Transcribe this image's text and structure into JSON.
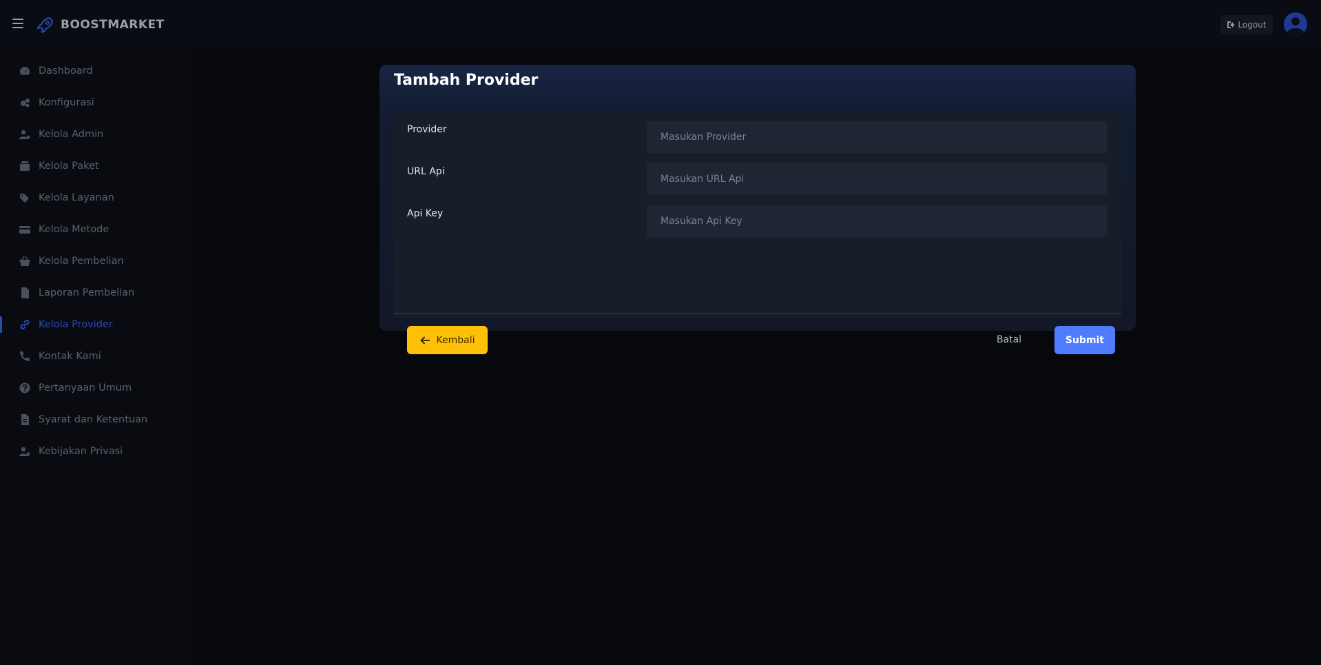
{
  "header": {
    "brand_name": "BOOSTMARKET",
    "logout_label": "Logout"
  },
  "sidebar": {
    "items": [
      {
        "label": "Dashboard",
        "icon": "dashboard-icon"
      },
      {
        "label": "Konfigurasi",
        "icon": "cogs-icon"
      },
      {
        "label": "Kelola Admin",
        "icon": "user-cog-icon"
      },
      {
        "label": "Kelola Paket",
        "icon": "box-icon"
      },
      {
        "label": "Kelola Layanan",
        "icon": "tags-icon"
      },
      {
        "label": "Kelola Metode",
        "icon": "credit-card-icon"
      },
      {
        "label": "Kelola Pembelian",
        "icon": "basket-icon"
      },
      {
        "label": "Laporan Pembelian",
        "icon": "file-icon"
      },
      {
        "label": "Kelola Provider",
        "icon": "link-icon",
        "active": true
      },
      {
        "label": "Kontak Kami",
        "icon": "phone-icon"
      },
      {
        "label": "Pertanyaan Umum",
        "icon": "question-circle-icon"
      },
      {
        "label": "Syarat dan Ketentuan",
        "icon": "file-contract-icon"
      },
      {
        "label": "Kebijakan Privasi",
        "icon": "user-shield-icon"
      }
    ]
  },
  "form": {
    "title": "Tambah Provider",
    "fields": [
      {
        "label": "Provider",
        "placeholder": "Masukan Provider",
        "value": ""
      },
      {
        "label": "URL Api",
        "placeholder": "Masukan URL Api",
        "value": ""
      },
      {
        "label": "Api Key",
        "placeholder": "Masukan Api Key",
        "value": ""
      }
    ],
    "back_label": "Kembali",
    "cancel_label": "Batal",
    "submit_label": "Submit"
  },
  "colors": {
    "accent": "#4f7cff",
    "warning": "#ffc107",
    "active_nav": "#2a4bb0",
    "background": "#07090e"
  }
}
